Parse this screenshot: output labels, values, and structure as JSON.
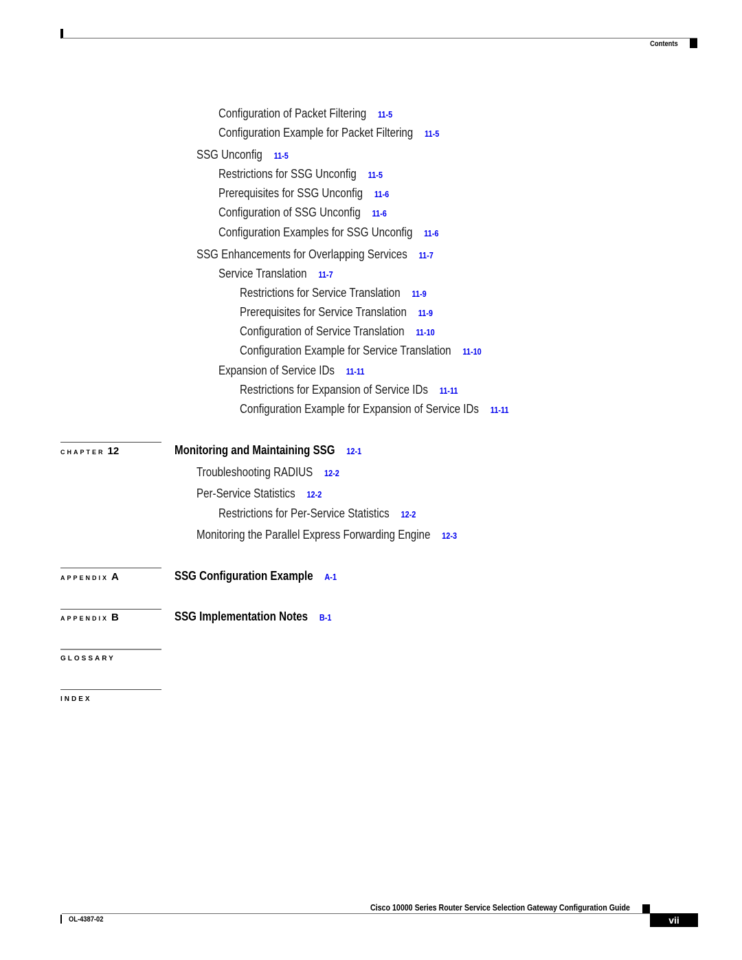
{
  "header": {
    "section_label": "Contents"
  },
  "entries_ch11_tail": [
    {
      "level": 2,
      "title": "Configuration of Packet Filtering",
      "page": "11-5"
    },
    {
      "level": 2,
      "title": "Configuration Example for Packet Filtering",
      "page": "11-5"
    },
    {
      "level": 1,
      "title": "SSG Unconfig",
      "page": "11-5"
    },
    {
      "level": 2,
      "title": "Restrictions for SSG Unconfig",
      "page": "11-5"
    },
    {
      "level": 2,
      "title": "Prerequisites for SSG Unconfig",
      "page": "11-6"
    },
    {
      "level": 2,
      "title": "Configuration of SSG Unconfig",
      "page": "11-6"
    },
    {
      "level": 2,
      "title": "Configuration Examples for SSG Unconfig",
      "page": "11-6"
    },
    {
      "level": 1,
      "title": "SSG Enhancements for Overlapping Services",
      "page": "11-7"
    },
    {
      "level": 2,
      "title": "Service Translation",
      "page": "11-7"
    },
    {
      "level": 3,
      "title": "Restrictions for Service Translation",
      "page": "11-9"
    },
    {
      "level": 3,
      "title": "Prerequisites for Service Translation",
      "page": "11-9"
    },
    {
      "level": 3,
      "title": "Configuration of Service Translation",
      "page": "11-10"
    },
    {
      "level": 3,
      "title": "Configuration Example for Service Translation",
      "page": "11-10"
    },
    {
      "level": 2,
      "title": "Expansion of Service IDs",
      "page": "11-11"
    },
    {
      "level": 3,
      "title": "Restrictions for Expansion of Service IDs",
      "page": "11-11"
    },
    {
      "level": 3,
      "title": "Configuration Example for Expansion of Service IDs",
      "page": "11-11"
    }
  ],
  "chapter12": {
    "label": "CHAPTER",
    "number": "12",
    "title": "Monitoring and Maintaining SSG",
    "page": "12-1",
    "entries": [
      {
        "level": 1,
        "title": "Troubleshooting RADIUS",
        "page": "12-2"
      },
      {
        "level": 1,
        "title": "Per-Service Statistics",
        "page": "12-2"
      },
      {
        "level": 2,
        "title": "Restrictions for Per-Service Statistics",
        "page": "12-2"
      },
      {
        "level": 1,
        "title": "Monitoring the Parallel Express Forwarding Engine",
        "page": "12-3"
      }
    ]
  },
  "appendixA": {
    "label": "APPENDIX",
    "letter": "A",
    "title": "SSG Configuration Example",
    "page": "A-1"
  },
  "appendixB": {
    "label": "APPENDIX",
    "letter": "B",
    "title": "SSG Implementation Notes",
    "page": "B-1"
  },
  "glossary": {
    "label": "GLOSSARY"
  },
  "index": {
    "label": "INDEX"
  },
  "footer": {
    "book_title": "Cisco 10000 Series Router Service Selection Gateway Configuration Guide",
    "doc_number": "OL-4387-02",
    "page_number": "vii"
  },
  "colors": {
    "link": "#0000ee",
    "text": "#1a1a1a",
    "rule": "#6a6a6a"
  }
}
